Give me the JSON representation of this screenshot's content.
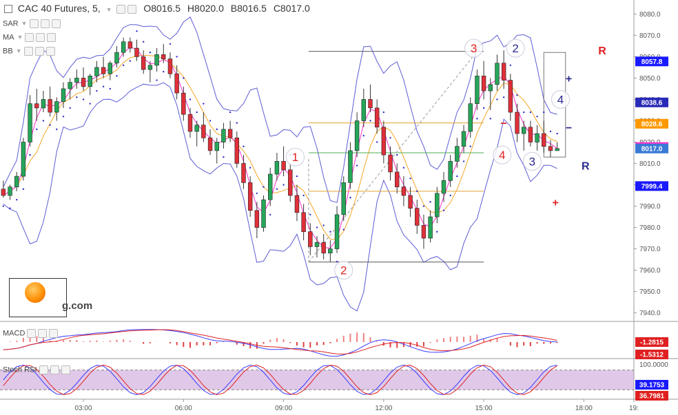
{
  "header": {
    "symbol": "CAC 40 Futures, 5,",
    "ohlc_open": "O8016.5",
    "ohlc_high": "H8020.0",
    "ohlc_low": "B8016.5",
    "ohlc_close": "C8017.0"
  },
  "indicators": [
    "SAR",
    "MA",
    "BB"
  ],
  "macd_label": "MACD",
  "stoch_label": "Stoch RSI",
  "watermark": "g.com",
  "chart_data": {
    "type": "candlestick",
    "price_axis": {
      "ticks": [
        7940,
        7950,
        7960,
        7970,
        7980,
        7990,
        8000,
        8010,
        8020,
        8030,
        8040,
        8050,
        8060,
        8070,
        8080
      ],
      "tick_labels": [
        "7940.0",
        "7950.0",
        "7960.0",
        "7970.0",
        "7980.0",
        "7990.0",
        "8000.0",
        "8010.0",
        "8020.0",
        "8030.0",
        "8040.0",
        "8050.0",
        "8060.0",
        "8070.0",
        "8080.0"
      ],
      "ylim": [
        7936,
        8084
      ]
    },
    "time_axis": {
      "labels": [
        "03:00",
        "06:00",
        "09:00",
        "12:00",
        "15:00",
        "18:00",
        "19:"
      ],
      "label_hours": [
        3,
        6,
        9,
        12,
        15,
        18,
        19.5
      ],
      "xlim": [
        0.5,
        19.5
      ]
    },
    "price_tags": [
      {
        "value": "8057.8",
        "color": "#1a1aff",
        "y": 8057.8
      },
      {
        "value": "8038.6",
        "color": "#2a2ab8",
        "y": 8038.6
      },
      {
        "value": "8028.6",
        "color": "#ff9800",
        "y": 8028.6
      },
      {
        "value": "8017.7",
        "color": "#ff33cc",
        "y": 8017.7
      },
      {
        "value": "8017.0",
        "color": "#3a7ad6",
        "y": 8017.0
      },
      {
        "value": "7999.4",
        "color": "#1a1aff",
        "y": 7999.4
      }
    ],
    "horizontal_levels": [
      {
        "y": 8062.5,
        "x1": 9.75,
        "x2": 15.0,
        "color": "#555555"
      },
      {
        "y": 8029,
        "x1": 9.75,
        "x2": 15.0,
        "color": "#e0a030"
      },
      {
        "y": 8015,
        "x1": 9.75,
        "x2": 15.0,
        "color": "#4caf50"
      },
      {
        "y": 7997,
        "x1": 9.75,
        "x2": 15.0,
        "color": "#e0a030"
      },
      {
        "y": 7963.8,
        "x1": 9.75,
        "x2": 15.0,
        "color": "#555555"
      }
    ],
    "candles": [
      [
        0.6,
        7998,
        8002,
        7994,
        7995
      ],
      [
        0.8,
        7995,
        8000,
        7993,
        7999
      ],
      [
        1.0,
        7999,
        8006,
        7997,
        8004
      ],
      [
        1.2,
        8004,
        8022,
        8002,
        8020
      ],
      [
        1.4,
        8020,
        8042,
        8018,
        8038
      ],
      [
        1.6,
        8038,
        8045,
        8030,
        8036
      ],
      [
        1.8,
        8036,
        8044,
        8034,
        8040
      ],
      [
        2.0,
        8040,
        8046,
        8032,
        8034
      ],
      [
        2.2,
        8034,
        8041,
        8030,
        8039
      ],
      [
        2.4,
        8039,
        8048,
        8036,
        8045
      ],
      [
        2.6,
        8045,
        8050,
        8040,
        8048
      ],
      [
        2.8,
        8048,
        8054,
        8045,
        8050
      ],
      [
        3.0,
        8050,
        8055,
        8044,
        8046
      ],
      [
        3.2,
        8046,
        8052,
        8042,
        8051
      ],
      [
        3.4,
        8051,
        8058,
        8048,
        8055
      ],
      [
        3.6,
        8055,
        8060,
        8050,
        8052
      ],
      [
        3.8,
        8052,
        8058,
        8049,
        8057
      ],
      [
        4.0,
        8057,
        8065,
        8055,
        8062
      ],
      [
        4.2,
        8062,
        8069,
        8060,
        8067
      ],
      [
        4.4,
        8067,
        8069,
        8062,
        8064
      ],
      [
        4.6,
        8064,
        8068,
        8058,
        8060
      ],
      [
        4.8,
        8060,
        8063,
        8052,
        8054
      ],
      [
        5.0,
        8054,
        8058,
        8048,
        8056
      ],
      [
        5.2,
        8056,
        8064,
        8053,
        8061
      ],
      [
        5.4,
        8061,
        8066,
        8057,
        8059
      ],
      [
        5.6,
        8059,
        8062,
        8050,
        8052
      ],
      [
        5.8,
        8052,
        8056,
        8040,
        8043
      ],
      [
        6.0,
        8043,
        8046,
        8030,
        8033
      ],
      [
        6.2,
        8033,
        8036,
        8022,
        8025
      ],
      [
        6.4,
        8025,
        8030,
        8018,
        8028
      ],
      [
        6.6,
        8028,
        8034,
        8020,
        8022
      ],
      [
        6.8,
        8022,
        8026,
        8014,
        8016
      ],
      [
        7.0,
        8016,
        8022,
        8010,
        8020
      ],
      [
        7.2,
        8020,
        8029,
        8017,
        8026
      ],
      [
        7.4,
        8026,
        8030,
        8020,
        8022
      ],
      [
        7.6,
        8022,
        8025,
        8008,
        8010
      ],
      [
        7.8,
        8010,
        8014,
        7998,
        8001
      ],
      [
        8.0,
        8001,
        8004,
        7985,
        7988
      ],
      [
        8.2,
        7988,
        7992,
        7975,
        7980
      ],
      [
        8.4,
        7980,
        7995,
        7978,
        7993
      ],
      [
        8.6,
        7993,
        8008,
        7990,
        8005
      ],
      [
        8.8,
        8005,
        8015,
        8002,
        8011
      ],
      [
        9.0,
        8011,
        8018,
        8004,
        8007
      ],
      [
        9.2,
        8007,
        8010,
        7992,
        7995
      ],
      [
        9.4,
        7995,
        8000,
        7983,
        7987
      ],
      [
        9.6,
        7987,
        7991,
        7974,
        7978
      ],
      [
        9.8,
        7978,
        7982,
        7967,
        7971
      ],
      [
        10.0,
        7971,
        7976,
        7966,
        7973
      ],
      [
        10.2,
        7973,
        7977,
        7965,
        7968
      ],
      [
        10.4,
        7968,
        7974,
        7964,
        7970
      ],
      [
        10.6,
        7970,
        7990,
        7968,
        7986
      ],
      [
        10.8,
        7986,
        8004,
        7983,
        8001
      ],
      [
        11.0,
        8001,
        8020,
        7998,
        8016
      ],
      [
        11.2,
        8016,
        8034,
        8013,
        8030
      ],
      [
        11.4,
        8030,
        8045,
        8027,
        8040
      ],
      [
        11.6,
        8040,
        8047,
        8034,
        8036
      ],
      [
        11.8,
        8036,
        8040,
        8024,
        8027
      ],
      [
        12.0,
        8027,
        8030,
        8010,
        8014
      ],
      [
        12.2,
        8014,
        8018,
        8002,
        8006
      ],
      [
        12.4,
        8006,
        8010,
        7996,
        7999
      ],
      [
        12.6,
        7999,
        8004,
        7990,
        7995
      ],
      [
        12.8,
        7995,
        7999,
        7985,
        7989
      ],
      [
        13.0,
        7989,
        7993,
        7977,
        7981
      ],
      [
        13.2,
        7981,
        7986,
        7970,
        7975
      ],
      [
        13.4,
        7975,
        7988,
        7973,
        7985
      ],
      [
        13.6,
        7985,
        7999,
        7982,
        7996
      ],
      [
        13.8,
        7996,
        8006,
        7992,
        8002
      ],
      [
        14.0,
        8002,
        8014,
        7999,
        8011
      ],
      [
        14.2,
        8011,
        8022,
        8008,
        8018
      ],
      [
        14.4,
        8018,
        8028,
        8015,
        8025
      ],
      [
        14.6,
        8025,
        8041,
        8022,
        8038
      ],
      [
        14.8,
        8038,
        8054,
        8035,
        8051
      ],
      [
        15.0,
        8051,
        8058,
        8040,
        8044
      ],
      [
        15.2,
        8044,
        8050,
        8035,
        8047
      ],
      [
        15.4,
        8047,
        8061,
        8044,
        8057
      ],
      [
        15.6,
        8057,
        8063,
        8045,
        8049
      ],
      [
        15.8,
        8049,
        8052,
        8030,
        8034
      ],
      [
        16.0,
        8034,
        8038,
        8020,
        8024
      ],
      [
        16.2,
        8024,
        8030,
        8016,
        8027
      ],
      [
        16.4,
        8027,
        8030,
        8018,
        8020
      ],
      [
        16.6,
        8020,
        8028,
        8016,
        8024
      ],
      [
        16.8,
        8024,
        8030,
        8015,
        8018
      ],
      [
        17.0,
        8018,
        8021,
        8013,
        8016
      ],
      [
        17.2,
        8016,
        8020,
        8016,
        8017
      ]
    ],
    "wave_labels": [
      {
        "text": "1",
        "x": 9.35,
        "y": 8013,
        "color": "#e02020"
      },
      {
        "text": "2",
        "x": 10.8,
        "y": 7960,
        "color": "#e02020"
      },
      {
        "text": "3",
        "x": 14.7,
        "y": 8064,
        "color": "#e02020"
      },
      {
        "text": "2",
        "x": 15.95,
        "y": 8064,
        "color": "#2a2a8f"
      },
      {
        "text": "4",
        "x": 15.55,
        "y": 8014,
        "color": "#e02020"
      },
      {
        "text": "3",
        "x": 16.45,
        "y": 8011,
        "color": "#2a2a8f"
      },
      {
        "text": "4",
        "x": 17.3,
        "y": 8040,
        "color": "#2a2a8f"
      }
    ],
    "markers": [
      {
        "text": "R",
        "x": 18.55,
        "y": 8063,
        "color": "#e02020"
      },
      {
        "text": "R",
        "x": 18.05,
        "y": 8009,
        "color": "#2a2a8f"
      },
      {
        "text": "+",
        "x": 17.55,
        "y": 8050,
        "color": "#2a2a8f"
      },
      {
        "text": "−",
        "x": 17.55,
        "y": 8027,
        "color": "#2a2a8f"
      },
      {
        "text": "+",
        "x": 17.15,
        "y": 7992,
        "color": "#e02020"
      },
      {
        "text": "−",
        "x": 15.6,
        "y": 8029,
        "color": "#e02020"
      }
    ],
    "macd": {
      "label": "MACD",
      "values": [
        "-1.2815",
        "-1.5312"
      ],
      "colors": [
        "#e02020",
        "#e02020"
      ]
    },
    "stoch_rsi": {
      "label": "Stoch RSI",
      "top_label": "100.0000",
      "values": [
        "39.1753",
        "36.7981"
      ],
      "colors": [
        "#1a1aff",
        "#e02020"
      ],
      "band": [
        20,
        80
      ]
    }
  }
}
